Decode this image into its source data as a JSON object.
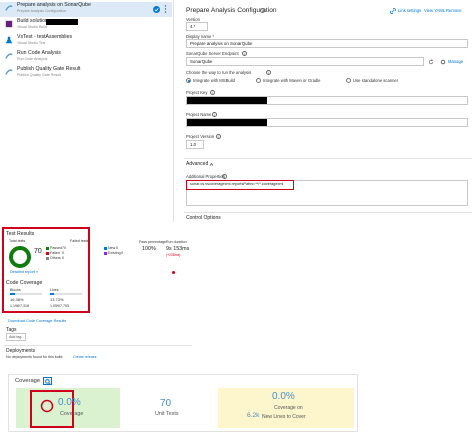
{
  "tasks": [
    {
      "title": "Prepare analysis on SonarQube",
      "subtitle": "Prepare Analysis Configuration",
      "selected": true
    },
    {
      "title": "Build solution",
      "subtitle": "Visual Studio Build",
      "selected": false
    },
    {
      "title": "VsTest - testAssemblies",
      "subtitle": "Visual Studio Test",
      "selected": false
    },
    {
      "title": "Run Code Analysis",
      "subtitle": "Run Code Analysis",
      "selected": false
    },
    {
      "title": "Publish Quality Gate Result",
      "subtitle": "Publish Quality Gate Result",
      "selected": false
    }
  ],
  "form": {
    "heading": "Prepare Analysis Configuration",
    "link_settings": "Link settings",
    "view_yaml": "View YAML",
    "remove": "Remove",
    "version_label": "Version",
    "version_value": "4.*",
    "display_name_label": "Display name *",
    "display_name_value": "Prepare analysis on SonarQube",
    "endpoint_label": "SonarQube Server Endpoint",
    "endpoint_value": "SonarQube",
    "manage": "Manage",
    "choose_label": "Choose the way to run the analysis",
    "radio_options": [
      "Integrate with MSBuild",
      "Integrate with Maven or Gradle",
      "Use standalone scanner"
    ],
    "project_key_label": "Project Key",
    "project_name_label": "Project Name",
    "project_version_label": "Project Version",
    "project_version_value": "1.0",
    "advanced_label": "Advanced",
    "additional_label": "Additional Properties",
    "additional_value": "sonar.cs.vscoveragexml.reportsPaths=**/*.coveragexml",
    "control_options": "Control Options"
  },
  "test_results": {
    "title": "Test Results",
    "total_tests_label": "Total tests",
    "total_tests": "70",
    "failed_tests_label": "Failed tests",
    "legend": [
      {
        "label": "Passed",
        "count": "70",
        "color": "#107c10"
      },
      {
        "label": "Failed",
        "count": "0",
        "color": "#d0021b"
      },
      {
        "label": "Others",
        "count": "0",
        "color": "#888888"
      }
    ],
    "legend2": [
      {
        "label": "New",
        "count": "0"
      },
      {
        "label": "Existing",
        "count": "0"
      }
    ],
    "pass_pct_label": "Pass percentage",
    "pass_pct": "100%",
    "run_duration_label": "Run duration",
    "run_duration": "9s 153ms",
    "run_duration_delta": "(+208ms)",
    "detailed_report": "Detailed report »",
    "code_coverage_title": "Code Coverage",
    "blocks_label": "Blocks",
    "blocks_pct": "16.38%",
    "blocks_ratio": "1,198/7,318",
    "lines_label": "Lines",
    "lines_pct": "13.73%",
    "lines_ratio": "1,059/7,705",
    "download_link": "Download Code Coverage Results",
    "tags_title": "Tags",
    "add_tag": "Add tag...",
    "deployments_title": "Deployments",
    "no_deploy": "No deployments found for this build.",
    "create_release": "Create release"
  },
  "coverage_widget": {
    "title": "Coverage",
    "coverage_value": "0.0%",
    "coverage_label": "Coverage",
    "unit_tests_value": "70",
    "unit_tests_label": "Unit Tests",
    "new_coverage_value": "0.0%",
    "new_coverage_label": "Coverage on",
    "new_lines_value": "6.2k",
    "new_lines_label": "New Lines to Cover"
  },
  "colors": {
    "accent": "#0078d4",
    "highlight": "#d0021b",
    "passed": "#107c10",
    "quality_green_bg": "#daf2d0",
    "quality_yellow_bg": "#fdf5cc"
  }
}
